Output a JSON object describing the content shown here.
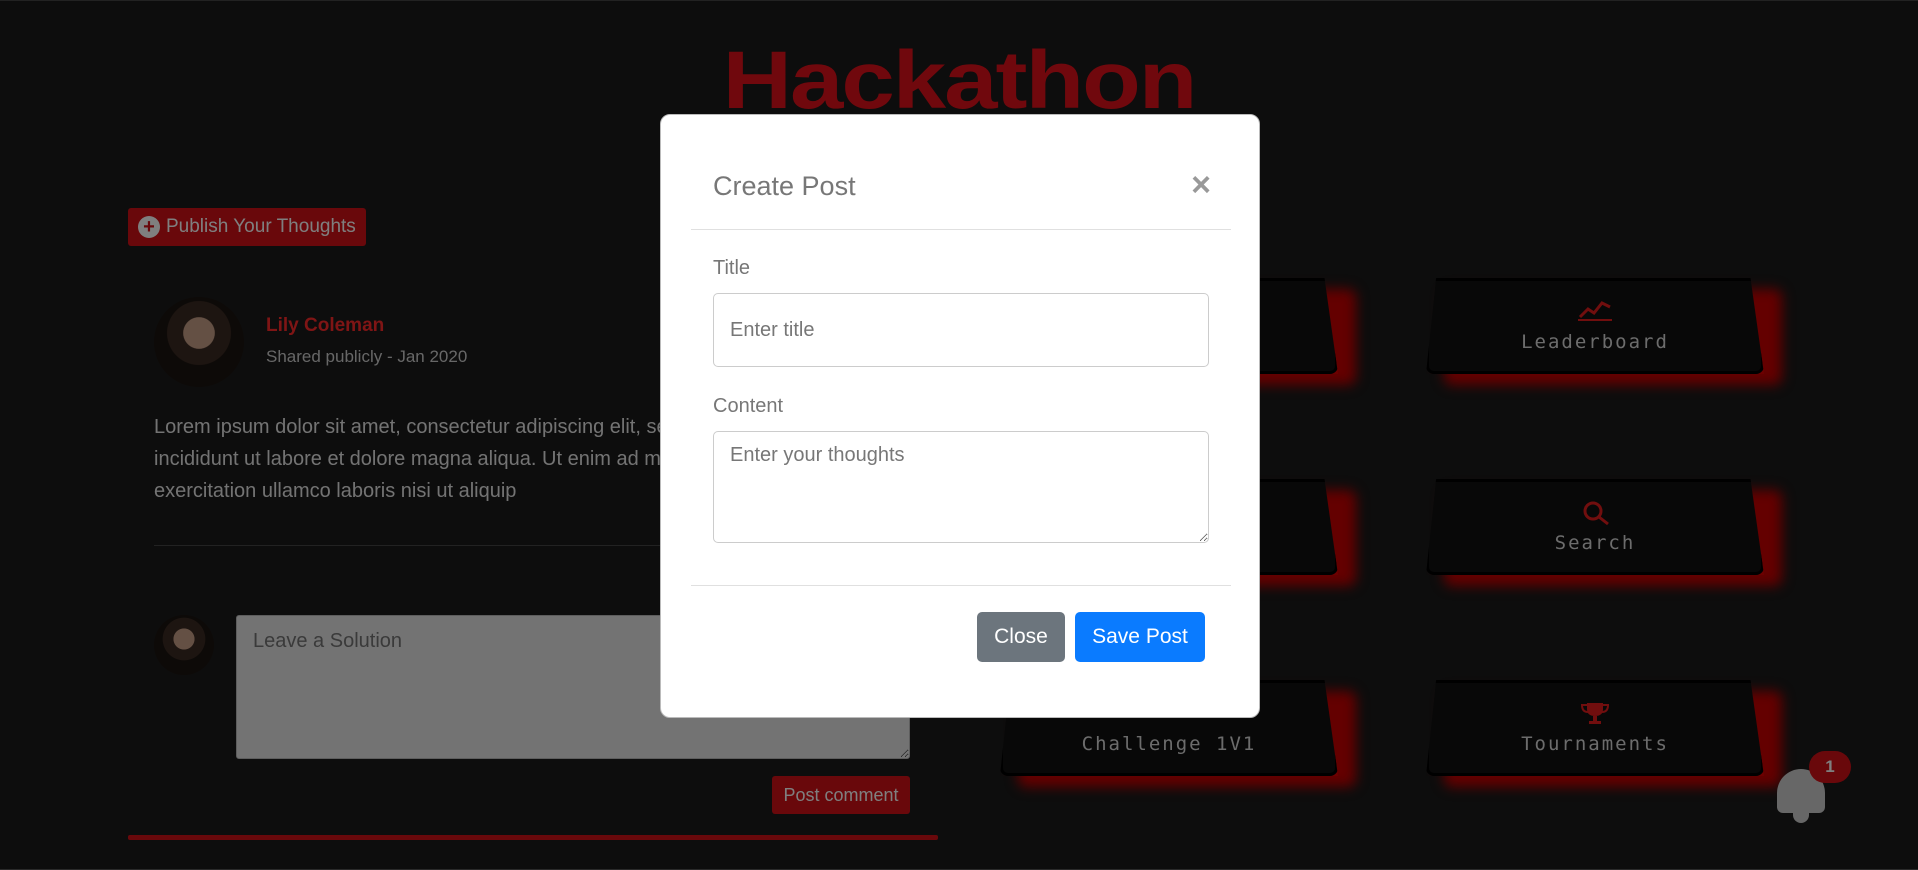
{
  "header": {
    "title": "Hackathon"
  },
  "publish": {
    "label": "Publish Your Thoughts",
    "icon": "plus-circle-icon"
  },
  "post": {
    "author": "Lily Coleman",
    "meta": "Shared publicly - Jan 2020",
    "body": "Lorem ipsum dolor sit amet, consectetur adipiscing elit, sed do eiusmod tempor incididunt ut labore et dolore magna aliqua. Ut enim ad minim veniam, quis nostrud exercitation ullamco laboris nisi ut aliquip"
  },
  "comment": {
    "placeholder": "Leave a Solution",
    "submit_label": "Post comment"
  },
  "tiles": [
    {
      "label": "",
      "icon": ""
    },
    {
      "label": "Leaderboard",
      "icon": "chart-line-icon"
    },
    {
      "label": "",
      "icon": ""
    },
    {
      "label": "Search",
      "icon": "search-icon"
    },
    {
      "label": "Challenge 1V1",
      "icon": ""
    },
    {
      "label": "Tournaments",
      "icon": "trophy-icon"
    }
  ],
  "notifications": {
    "count": "1",
    "icon": "bell-icon"
  },
  "modal": {
    "title": "Create Post",
    "close_symbol": "×",
    "title_label": "Title",
    "title_placeholder": "Enter title",
    "content_label": "Content",
    "content_placeholder": "Enter your thoughts",
    "close_label": "Close",
    "save_label": "Save Post"
  },
  "colors": {
    "accent": "#d31017",
    "primary": "#0a7bff",
    "secondary": "#6c757d"
  }
}
